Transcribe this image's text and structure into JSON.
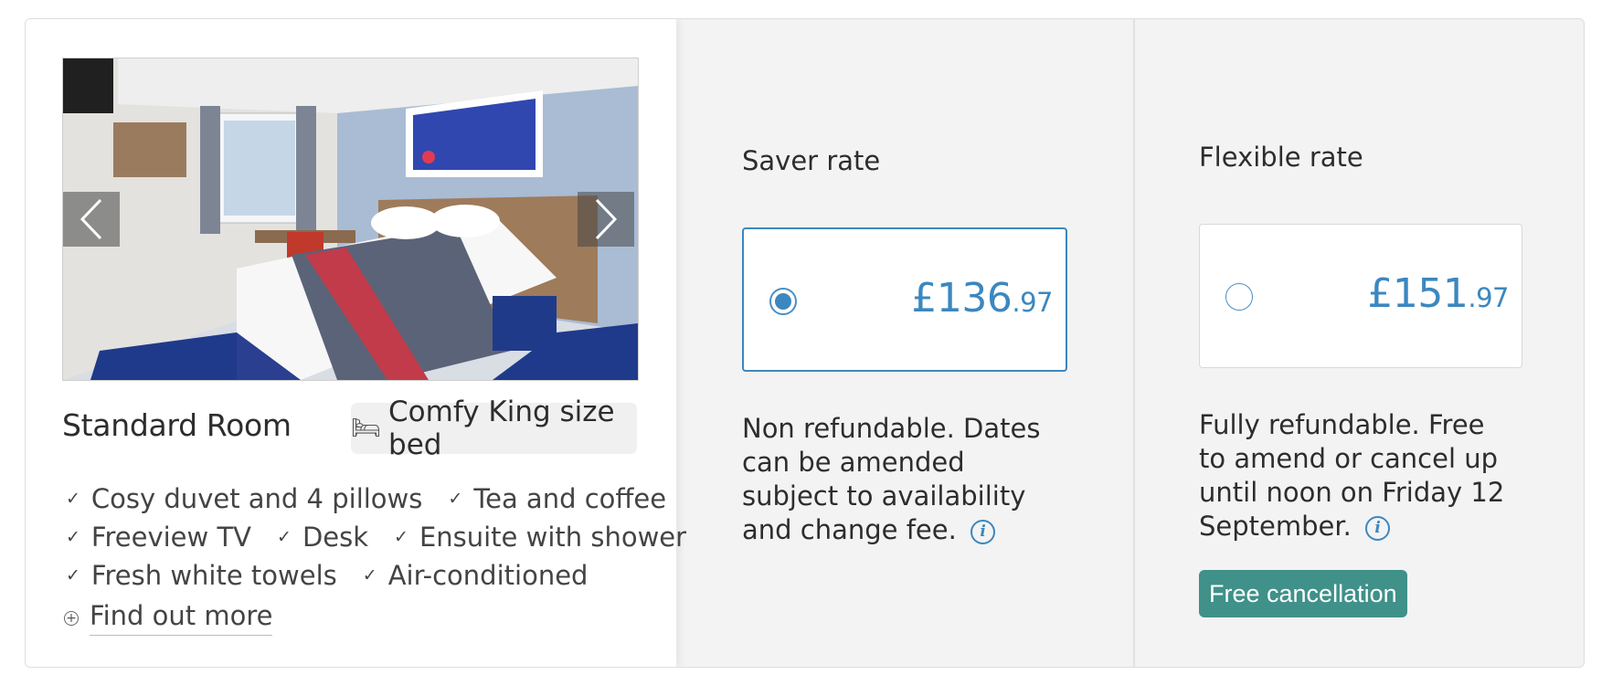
{
  "room": {
    "title": "Standard Room",
    "bed_label": "Comfy King size bed",
    "bed_icon": "bed-icon",
    "prev_icon": "chevron-left-icon",
    "next_icon": "chevron-right-icon",
    "amenity_rows": [
      [
        "Cosy duvet and 4 pillows",
        "Tea and coffee"
      ],
      [
        "Freeview TV",
        "Desk",
        "Ensuite with shower"
      ],
      [
        "Fresh white towels",
        "Air-conditioned"
      ]
    ],
    "find_more_label": "Find out more"
  },
  "saver": {
    "title": "Saver rate",
    "price_pounds": "£136",
    "price_pence": ".97",
    "selected": true,
    "description": "Non refundable. Dates can be amended subject to availability and change fee."
  },
  "flexible": {
    "title": "Flexible rate",
    "price_pounds": "£151",
    "price_pence": ".97",
    "selected": false,
    "description": "Fully refundable. Free to amend or cancel up until noon on Friday 12 September.",
    "badge": "Free cancellation"
  },
  "colors": {
    "accent": "#3c87bf",
    "badge_bg": "#3f9189",
    "panel_bg": "#f3f3f3"
  }
}
